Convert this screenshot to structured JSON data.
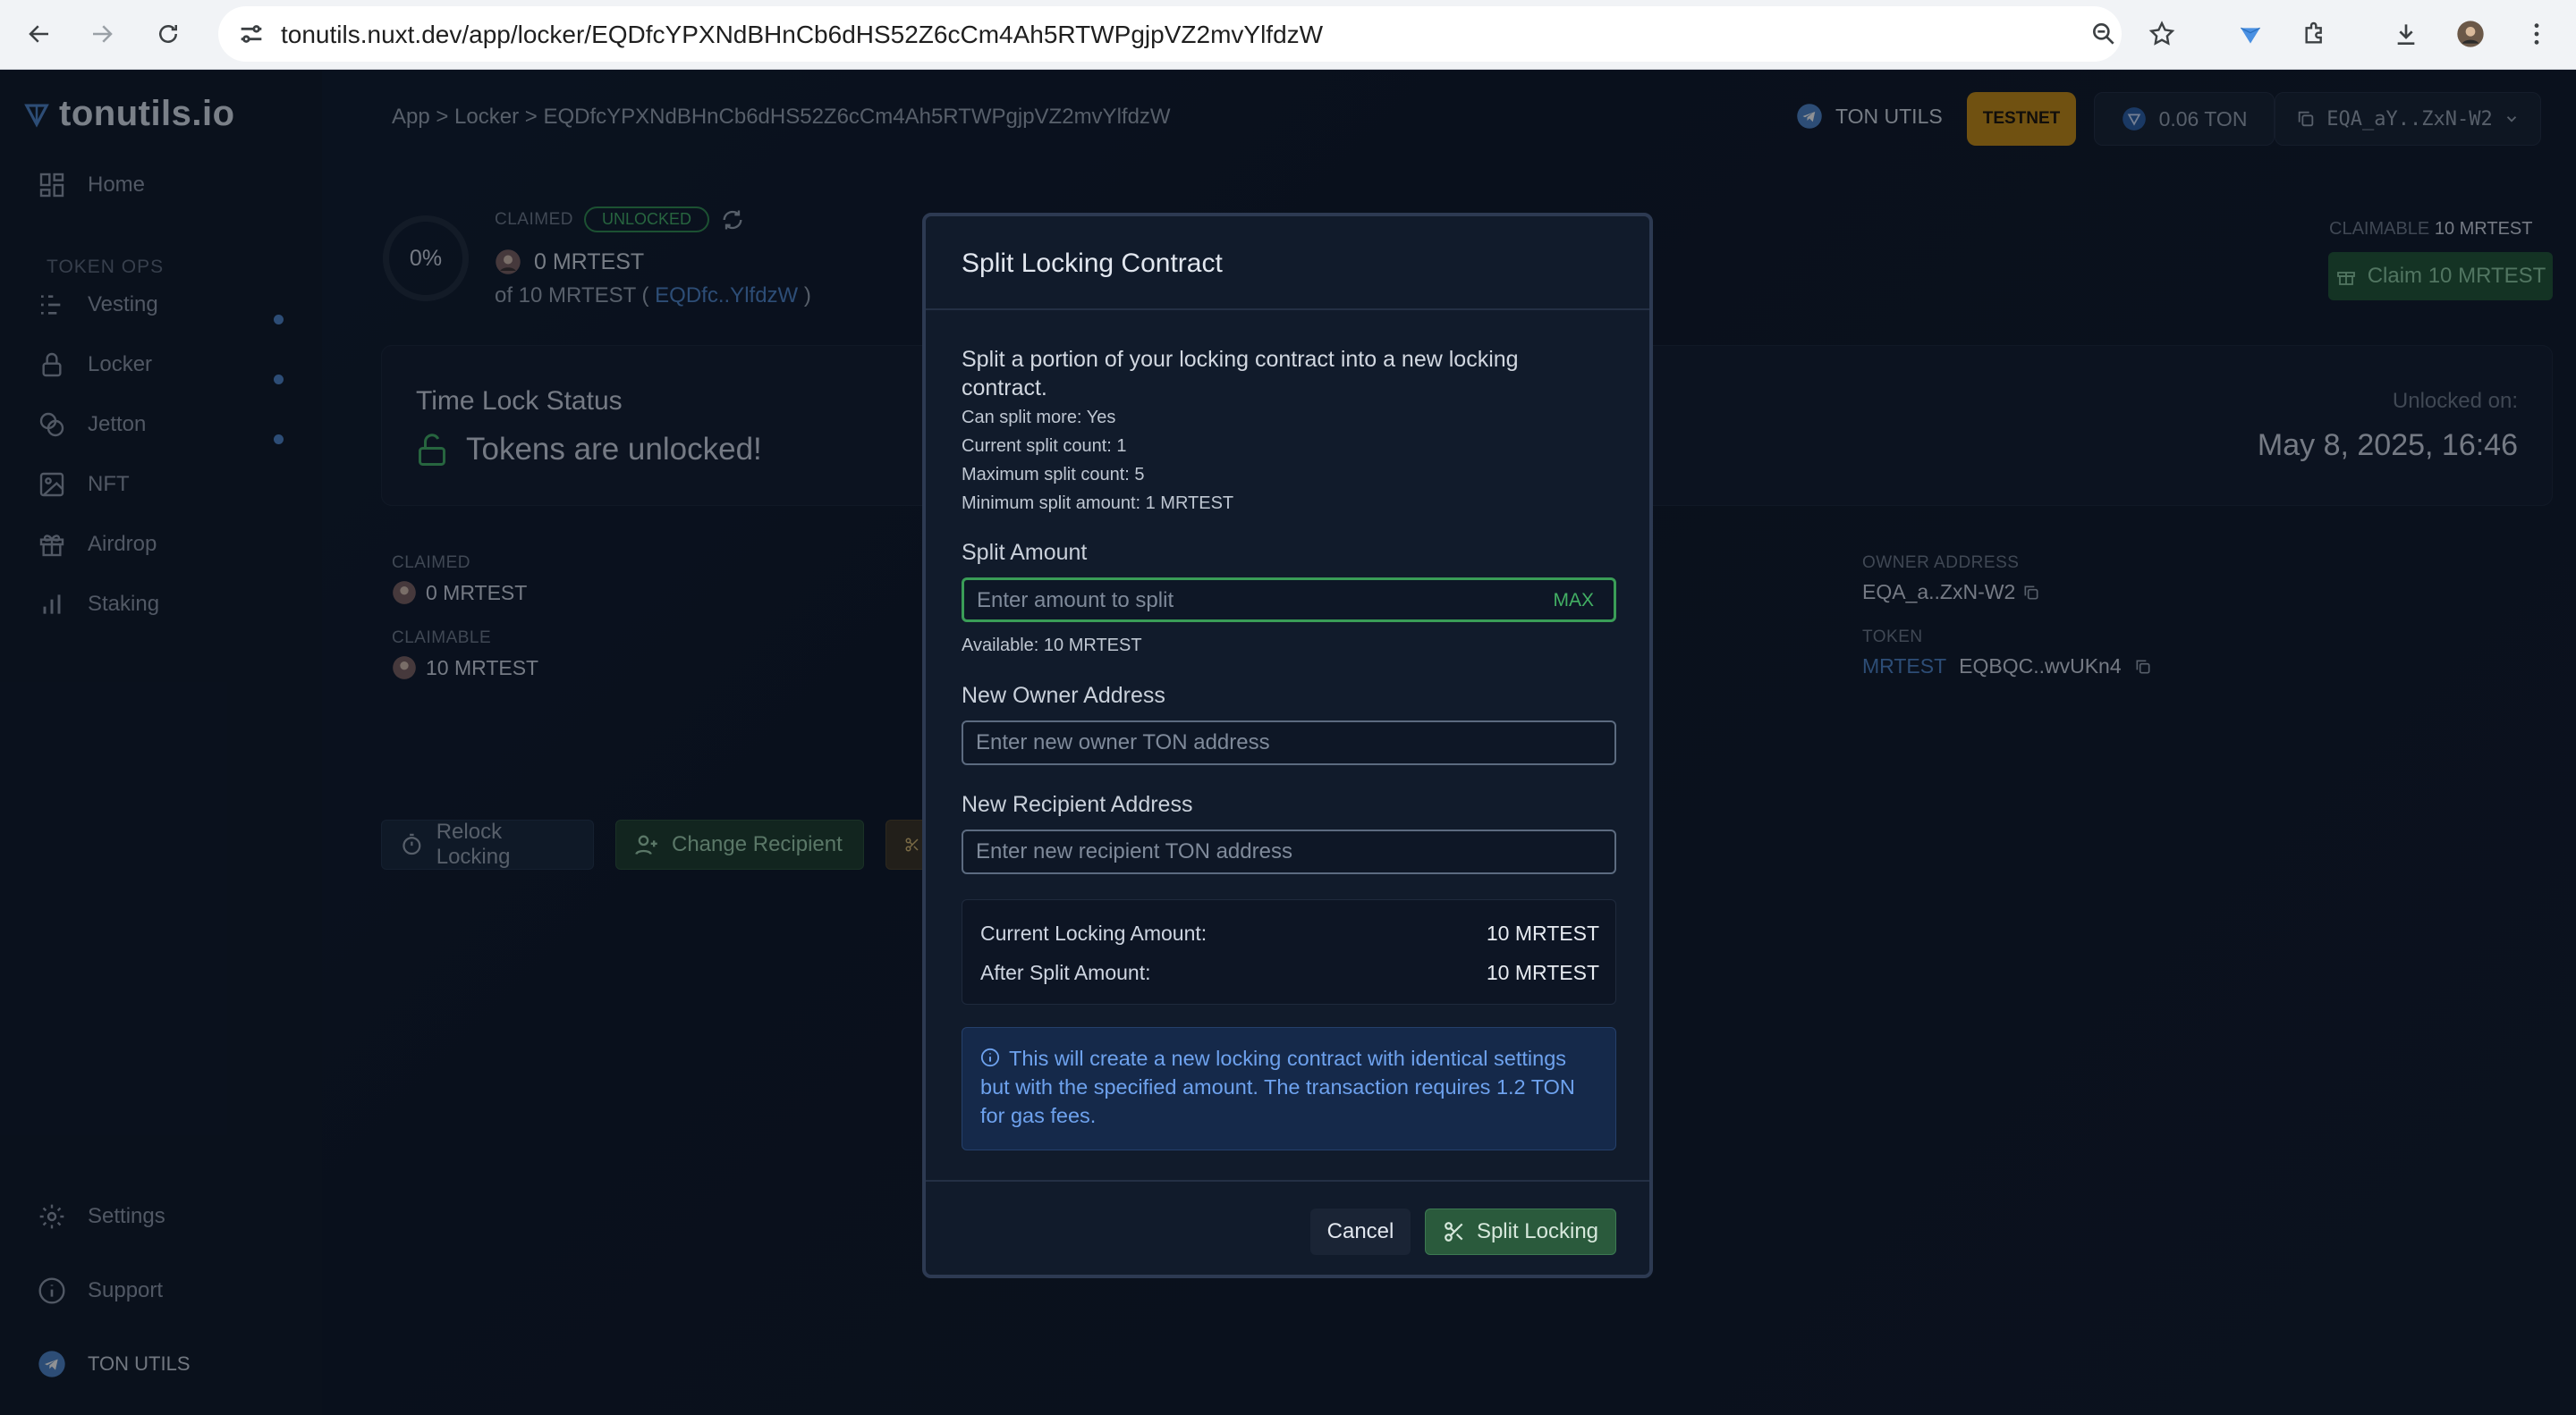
{
  "browser": {
    "url_domain": "tonutils.nuxt.dev",
    "url_path": "/app/locker/EQDfcYPXNdBHnCb6dHS52Z6cCm4Ah5RTWPgjpVZ2mvYlfdzW"
  },
  "app": {
    "logo_text": "tonutils.io",
    "breadcrumb": "App > Locker > EQDfcYPXNdBHnCb6dHS52Z6cCm4Ah5RTWPgjpVZ2mvYlfdzW",
    "header": {
      "ton_utils_label": "TON UTILS",
      "network_badge": "TESTNET",
      "balance": "0.06 TON",
      "wallet": "EQA_aY..ZxN-W2"
    },
    "sidebar": {
      "home": "Home",
      "section_label": "TOKEN OPS",
      "items": [
        "Vesting",
        "Locker",
        "Jetton",
        "NFT",
        "Airdrop",
        "Staking"
      ],
      "settings": "Settings",
      "support": "Support",
      "footer": "TON UTILS"
    },
    "locker": {
      "progress": "0%",
      "claimed_label": "CLAIMED",
      "status": "UNLOCKED",
      "claimed_amount": "0 MRTEST",
      "of_total_prefix": "of 10 MRTEST (",
      "of_total_link": "EQDfc..YlfdzW",
      "of_total_suffix": ")",
      "claimable_label": "CLAIMABLE",
      "claimable_value": "10 MRTEST",
      "claim_button": "Claim 10 MRTEST",
      "time_lock_title": "Time Lock Status",
      "time_lock_status": "Tokens are unlocked!",
      "unlocked_on_label": "Unlocked on:",
      "unlocked_on_value": "May 8, 2025, 16:46",
      "details": {
        "claimed_label": "CLAIMED",
        "claimed_value": "0 MRTEST",
        "claimable_label": "CLAIMABLE",
        "claimable_value": "10 MRTEST",
        "owner_label": "OWNER ADDRESS",
        "owner_value": "EQA_a..ZxN-W2",
        "token_label": "TOKEN",
        "token_symbol": "MRTEST",
        "token_address": "EQBQC..wvUKn4"
      },
      "actions": {
        "relock": "Relock Locking",
        "change_recipient": "Change Recipient"
      }
    }
  },
  "modal": {
    "title": "Split Locking Contract",
    "description": "Split a portion of your locking contract into a new locking contract.",
    "info": [
      "Can split more: Yes",
      "Current split count: 1",
      "Maximum split count: 5",
      "Minimum split amount: 1 MRTEST"
    ],
    "split_amount_label": "Split Amount",
    "split_amount_placeholder": "Enter amount to split",
    "max_label": "MAX",
    "available": "Available: 10 MRTEST",
    "new_owner_label": "New Owner Address",
    "new_owner_placeholder": "Enter new owner TON address",
    "new_recipient_label": "New Recipient Address",
    "new_recipient_placeholder": "Enter new recipient TON address",
    "summary": {
      "current_label": "Current Locking Amount:",
      "current_value": "10 MRTEST",
      "after_label": "After Split Amount:",
      "after_value": "10 MRTEST"
    },
    "notice": "This will create a new locking contract with identical settings but with the specified amount. The transaction requires 1.2 TON for gas fees.",
    "cancel_label": "Cancel",
    "submit_label": "Split Locking"
  },
  "colors": {
    "accent_green": "#43b064",
    "testnet_badge": "#c78a12",
    "info_blue": "#6ea2ee"
  }
}
